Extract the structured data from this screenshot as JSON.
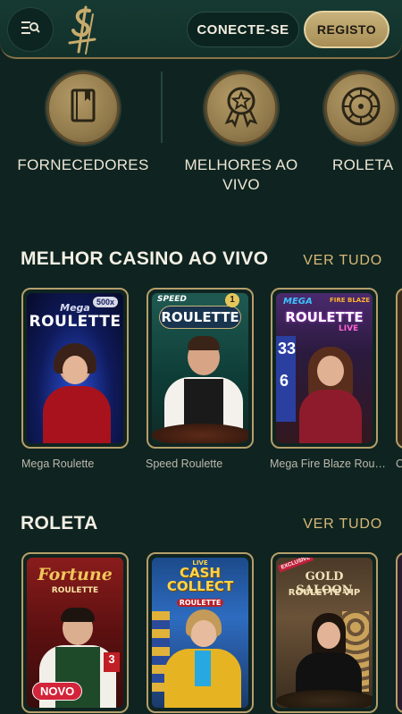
{
  "header": {
    "login_label": "CONECTE-SE",
    "register_label": "REGISTO"
  },
  "categories": [
    {
      "label": "FORNECEDORES",
      "icon": "book-icon"
    },
    {
      "label": "MELHORES AO VIVO",
      "icon": "award-ribbon-icon"
    },
    {
      "label": "ROLETA",
      "icon": "roulette-wheel-icon"
    }
  ],
  "sections": [
    {
      "title": "MELHOR CASINO AO VIVO",
      "see_all": "VER TUDO",
      "games": [
        {
          "name": "Mega Roulette",
          "art_title": "ROULETTE",
          "art_sub": "Mega",
          "badge_top": "500x"
        },
        {
          "name": "Speed Roulette",
          "art_title": "ROULETTE",
          "art_sub": "SPEED",
          "badge_top": "1"
        },
        {
          "name": "Mega Fire Blaze Rou…",
          "art_title": "ROULETTE",
          "art_sub": "MEGA",
          "art_sub2": "FIRE BLAZE",
          "art_live": "LIVE",
          "art_number1": "33",
          "art_number2": "6"
        },
        {
          "name": "C"
        }
      ]
    },
    {
      "title": "ROLETA",
      "see_all": "VER TUDO",
      "games": [
        {
          "art_title": "Fortune",
          "art_sub": "ROULETTE",
          "badge": "NOVO",
          "art_number": "3"
        },
        {
          "art_title": "CASH COLLECT",
          "art_sub": "ROULETTE",
          "art_top": "LIVE"
        },
        {
          "art_title": "GOLD SALOON",
          "art_sub": "ROULETTE VIP",
          "art_top": "EXCLUSIVE"
        }
      ]
    }
  ],
  "colors": {
    "background": "#0f2420",
    "accent_gold": "#d7b877",
    "new_badge": "#d3243a"
  }
}
